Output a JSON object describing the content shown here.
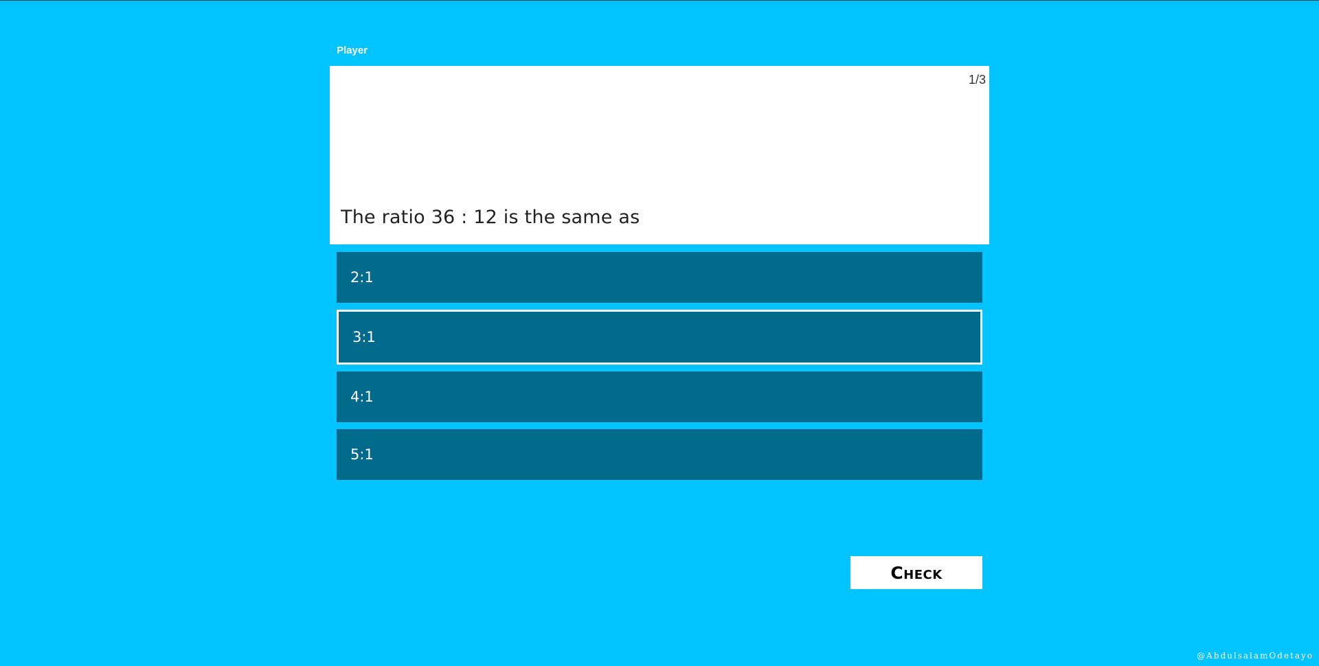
{
  "player": {
    "label": "Player"
  },
  "question": {
    "counter": "1/3",
    "text": "The ratio 36 : 12 is the same as"
  },
  "options": [
    {
      "label": "2:1",
      "selected": false
    },
    {
      "label": "3:1",
      "selected": true
    },
    {
      "label": "4:1",
      "selected": false
    },
    {
      "label": "5:1",
      "selected": false
    }
  ],
  "actions": {
    "check_label": "Check"
  },
  "footer": {
    "credit": "@AbdulsalamOdetayo"
  },
  "colors": {
    "background": "#00c3ff",
    "option_bg": "#006a8c",
    "card_bg": "#ffffff"
  }
}
